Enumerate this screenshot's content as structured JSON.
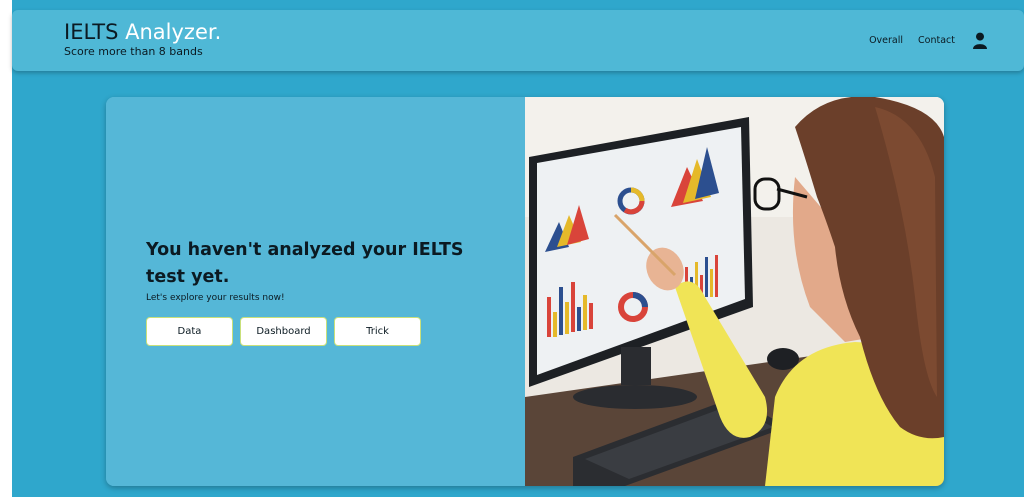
{
  "header": {
    "title_main": "IELTS ",
    "title_accent": "Analyzer.",
    "subtitle": "Score more than 8 bands",
    "nav": {
      "overall": "Overall",
      "contact": "Contact"
    },
    "profile_icon": "user-icon"
  },
  "hero": {
    "headline": "You haven't analyzed your IELTS test yet.",
    "subline": "Let's explore your results now!",
    "buttons": {
      "data": "Data",
      "dashboard": "Dashboard",
      "trick": "Trick"
    },
    "image_alt": "woman-pointing-at-monitor-with-charts"
  },
  "colors": {
    "page_bg": "#2fa7cc",
    "header_bg": "#4fb8d6",
    "card_bg": "#55b7d7",
    "accent_white": "#ffffff",
    "text_dark": "#0b1a22",
    "button_border": "#c9e07a"
  }
}
